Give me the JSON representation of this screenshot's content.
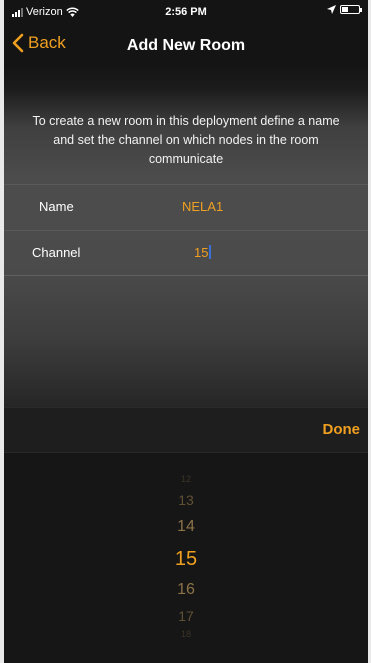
{
  "status_bar": {
    "carrier": "Verizon",
    "time": "2:56 PM",
    "icons": [
      "signal-icon",
      "wifi-icon",
      "location-arrow-icon",
      "battery-icon"
    ]
  },
  "nav": {
    "back_label": "Back",
    "title": "Add New Room"
  },
  "form": {
    "description": "To create a new room in this deployment define a name and set the channel on which nodes in the room communicate",
    "name_label": "Name",
    "name_value": "NELA1",
    "channel_label": "Channel",
    "channel_value": "15"
  },
  "picker": {
    "done_label": "Done",
    "options": [
      "12",
      "13",
      "14",
      "15",
      "16",
      "17",
      "18"
    ],
    "selected": "15"
  },
  "colors": {
    "accent": "#f0a020",
    "background": "#141414",
    "cursor": "#3a6fd8"
  }
}
